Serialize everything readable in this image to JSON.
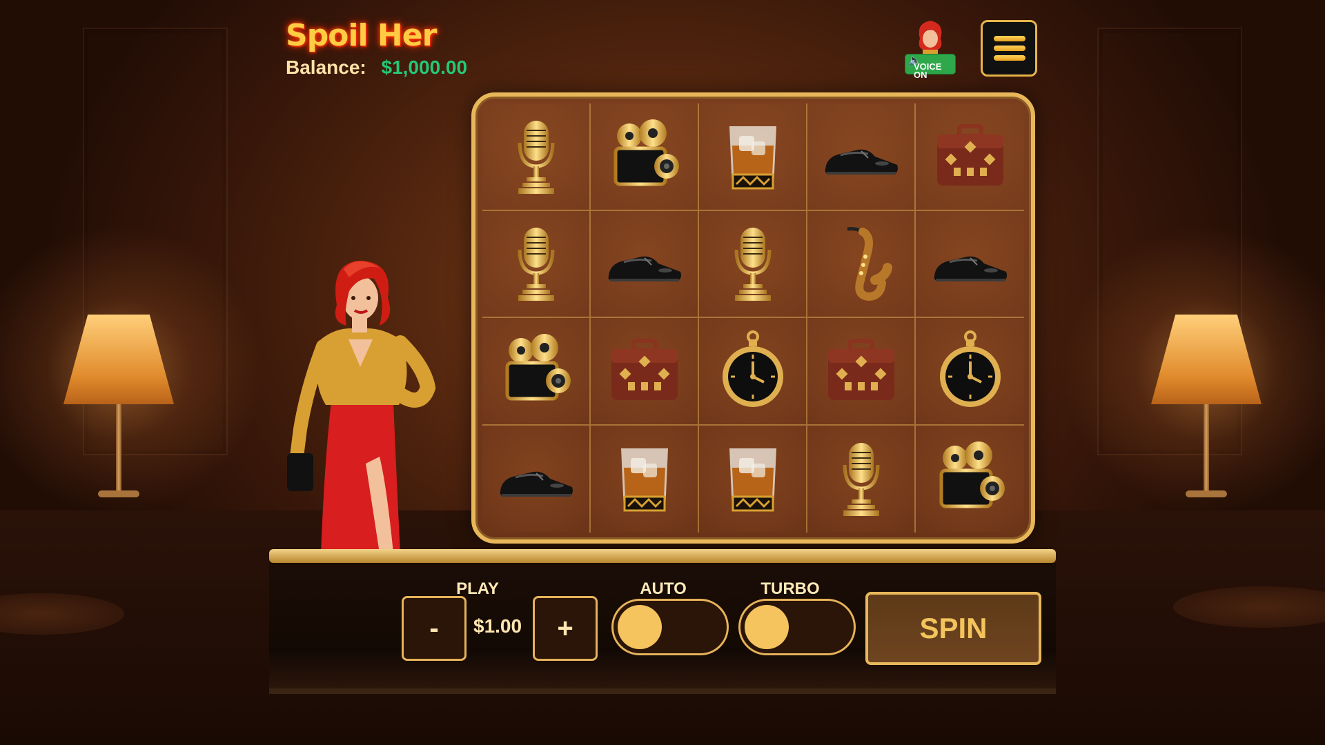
{
  "header": {
    "title": "Spoil Her",
    "balance_label": "Balance:",
    "balance_value": "$1,000.00"
  },
  "voice": {
    "label": "VOICE ON",
    "icon": "speaker-icon"
  },
  "menu": {
    "icon": "hamburger-menu-icon"
  },
  "reels": [
    [
      "microphone",
      "film-camera",
      "whiskey-glass",
      "shoe",
      "briefcase"
    ],
    [
      "microphone",
      "shoe",
      "microphone",
      "saxophone",
      "shoe"
    ],
    [
      "film-camera",
      "briefcase",
      "pocket-watch",
      "briefcase",
      "pocket-watch"
    ],
    [
      "shoe",
      "whiskey-glass",
      "whiskey-glass",
      "microphone",
      "film-camera"
    ]
  ],
  "controls": {
    "play_label": "PLAY",
    "bet_value": "$1.00",
    "minus_label": "-",
    "plus_label": "+",
    "auto_label": "AUTO",
    "turbo_label": "TURBO",
    "spin_label": "SPIN"
  },
  "colors": {
    "title": "#ffcc44",
    "balance_value": "#25c878",
    "gold_border": "#e8b75a",
    "voice_badge": "#2ea84a"
  }
}
